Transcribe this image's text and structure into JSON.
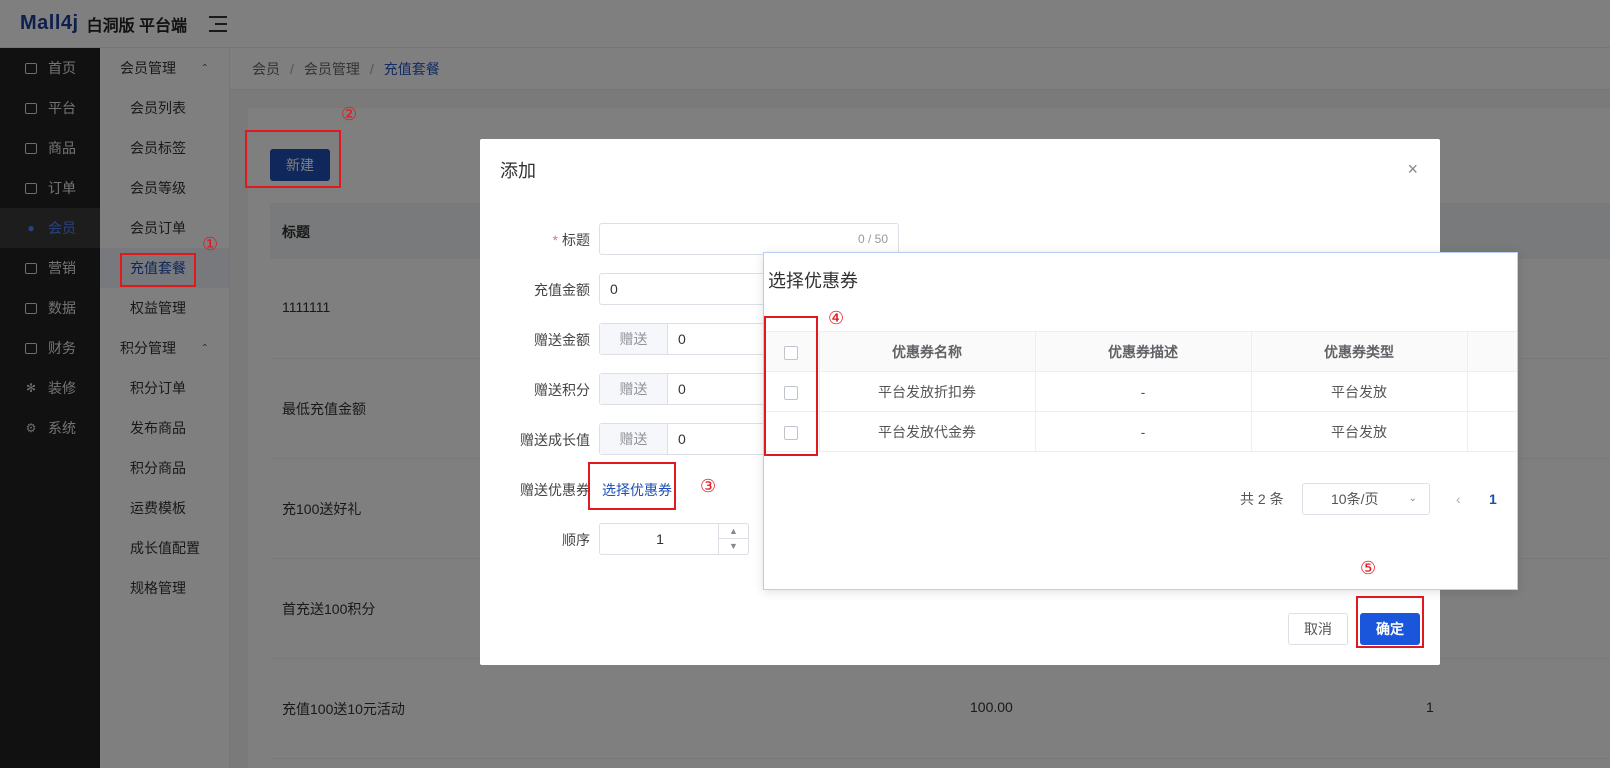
{
  "header": {
    "brand": "Mall4j",
    "subtitle": "白洞版 平台端"
  },
  "sidebar": {
    "items": [
      {
        "label": "首页",
        "icon": "monitor-icon"
      },
      {
        "label": "平台",
        "icon": "platform-icon"
      },
      {
        "label": "商品",
        "icon": "goods-icon"
      },
      {
        "label": "订单",
        "icon": "order-icon"
      },
      {
        "label": "会员",
        "icon": "members-icon",
        "active": true
      },
      {
        "label": "营销",
        "icon": "gift-icon"
      },
      {
        "label": "数据",
        "icon": "chart-icon"
      },
      {
        "label": "财务",
        "icon": "finance-icon"
      },
      {
        "label": "装修",
        "icon": "brush-icon"
      },
      {
        "label": "系统",
        "icon": "gear-icon"
      }
    ]
  },
  "submenu": {
    "group1": "会员管理",
    "group1_items": [
      "会员列表",
      "会员标签",
      "会员等级",
      "会员订单",
      "充值套餐",
      "权益管理"
    ],
    "group2": "积分管理",
    "group2_items": [
      "积分订单",
      "发布商品",
      "积分商品",
      "运费模板",
      "成长值配置",
      "规格管理"
    ]
  },
  "breadcrumb": {
    "l1": "会员",
    "l2": "会员管理",
    "l3": "充值套餐"
  },
  "main": {
    "new_button": "新建",
    "col_title": "标题",
    "rows": [
      {
        "title": "1111111",
        "amount": "",
        "order": ""
      },
      {
        "title": "最低充值金额",
        "amount": "",
        "order": ""
      },
      {
        "title": "充100送好礼",
        "amount": "",
        "order": ""
      },
      {
        "title": "首充送100积分",
        "amount": "",
        "order": ""
      },
      {
        "title": "充值100送10元活动",
        "amount": "100.00",
        "order": "1"
      }
    ]
  },
  "dialog": {
    "title": "添加",
    "close": "×",
    "fields": {
      "title_label": "标题",
      "title_counter": "0 / 50",
      "amount_label": "充值金额",
      "amount_value": "0",
      "gift_amount_label": "赠送金额",
      "gift_points_label": "赠送积分",
      "gift_growth_label": "赠送成长值",
      "gift_prefix": "赠送",
      "gift_value": "0",
      "gift_coupon_label": "赠送优惠券",
      "select_coupon": "选择优惠券",
      "order_label": "顺序",
      "order_value": "1"
    },
    "cancel": "取消",
    "confirm": "确定"
  },
  "coupon_popup": {
    "title": "选择优惠券",
    "columns": [
      "优惠券名称",
      "优惠券描述",
      "优惠券类型"
    ],
    "rows": [
      {
        "name": "平台发放折扣券",
        "desc": "-",
        "type": "平台发放"
      },
      {
        "name": "平台发放代金券",
        "desc": "-",
        "type": "平台发放"
      }
    ],
    "total": "共 2 条",
    "page_size": "10条/页",
    "current_page": "1"
  },
  "annotations": [
    "①",
    "②",
    "③",
    "④",
    "⑤"
  ],
  "colors": {
    "brand": "#1e3f9a",
    "primary": "#1f4fb5",
    "annotation": "#e0191f",
    "sidebar_bg": "#222222"
  }
}
